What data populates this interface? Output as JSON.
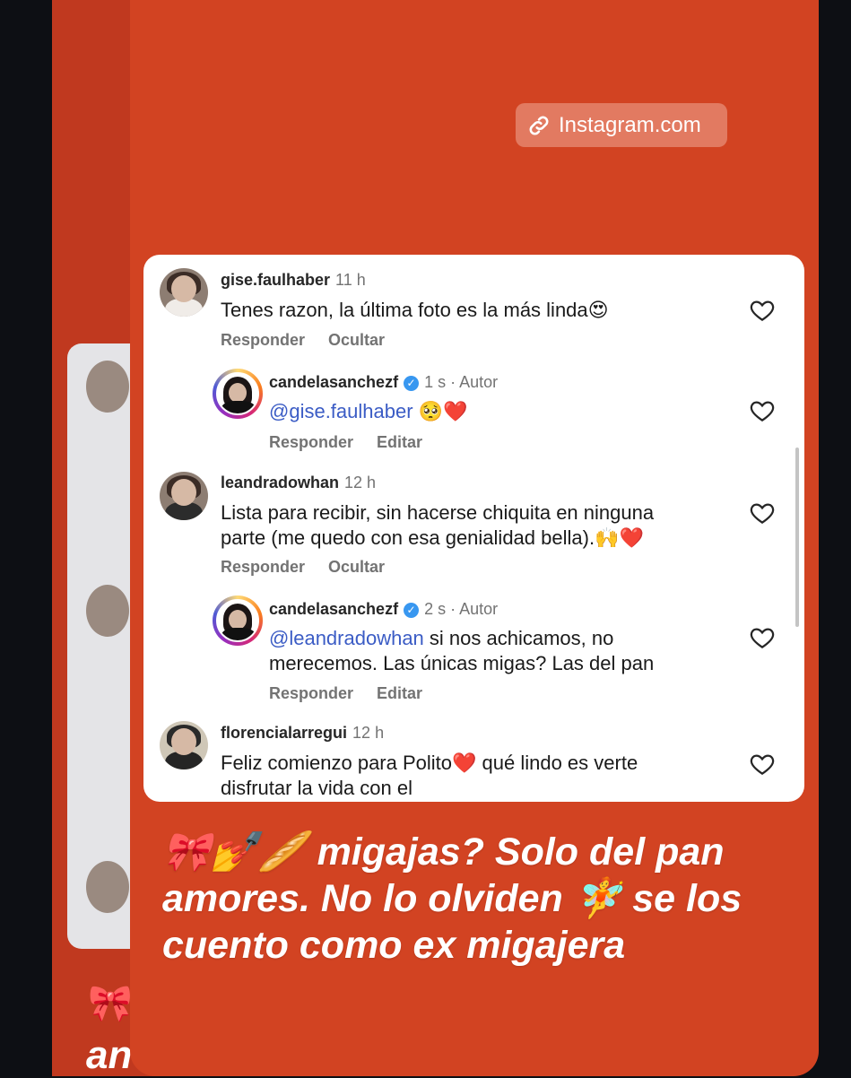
{
  "link": {
    "label": "Instagram.com",
    "icon": "link-icon"
  },
  "comments": [
    {
      "user": "gise.faulhaber",
      "time": "11 h",
      "text": "Tenes razon, la última foto es la más linda😍",
      "actions": [
        "Responder",
        "Ocultar"
      ]
    },
    {
      "user": "candelasanchezf",
      "time": "1 s",
      "badge": "Autor",
      "mention": "@gise.faulhaber",
      "text": " 🥺❤️",
      "actions": [
        "Responder",
        "Editar"
      ]
    },
    {
      "user": "leandradowhan",
      "time": "12 h",
      "text_line1": "Lista para recibir, sin hacerse chiquita en ninguna",
      "text_line2": "parte (me quedo con esa genialidad bella).🙌❤️",
      "actions": [
        "Responder",
        "Ocultar"
      ]
    },
    {
      "user": "candelasanchezf",
      "time": "2 s",
      "badge": "Autor",
      "mention": "@leandradowhan",
      "text_line1": " si nos achicamos, no",
      "text_line2": "merecemos. Las únicas migas? Las del pan",
      "actions": [
        "Responder",
        "Editar"
      ]
    },
    {
      "user": "florencialarregui",
      "time": "12 h",
      "text_line1": "Feliz comienzo para Polito❤️ qué lindo es verte",
      "text_line2": "disfrutar la vida con el"
    }
  ],
  "caption": {
    "line1": "🎀💅🥖 migajas? Solo del pan",
    "line2": "amores. No lo olviden 🧚 se los",
    "line3": "cuento como ex migajera"
  },
  "background": {
    "emoji": "🎀",
    "text": "an"
  },
  "colors": {
    "story_bg": "#d24322",
    "link_pill": "#e27a61",
    "mention": "#3b5cc5",
    "verified": "#3897f0"
  }
}
